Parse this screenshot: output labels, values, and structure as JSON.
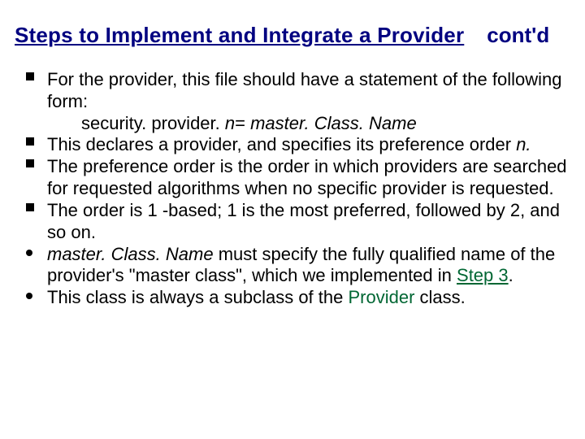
{
  "title": {
    "main": "Steps to Implement and Integrate a Provider",
    "cont": "cont'd"
  },
  "bullets": {
    "b1": {
      "line1": "For the provider, this file should have a statement of the following form:",
      "code_plain": "security. provider. ",
      "code_n": "n",
      "code_eq": "= ",
      "code_master": "master. Class. Name"
    },
    "b2": {
      "pre": " This declares a provider, and specifies its preference order ",
      "n": "n.",
      "post": ""
    },
    "b3": "The preference order is the order in which providers are searched for requested algorithms when no specific provider is requested.",
    "b4": " The order is 1 -based; 1 is the most preferred, followed by 2, and so on.",
    "b5": {
      "master": "master. Class. Name",
      "mid": " must specify the fully qualified name of the provider's \"master class\", which we implemented in ",
      "step": "Step 3",
      "dot": "."
    },
    "b6": {
      "pre": "This class is always a subclass of the ",
      "prov": "Provider",
      "post": " class."
    }
  }
}
